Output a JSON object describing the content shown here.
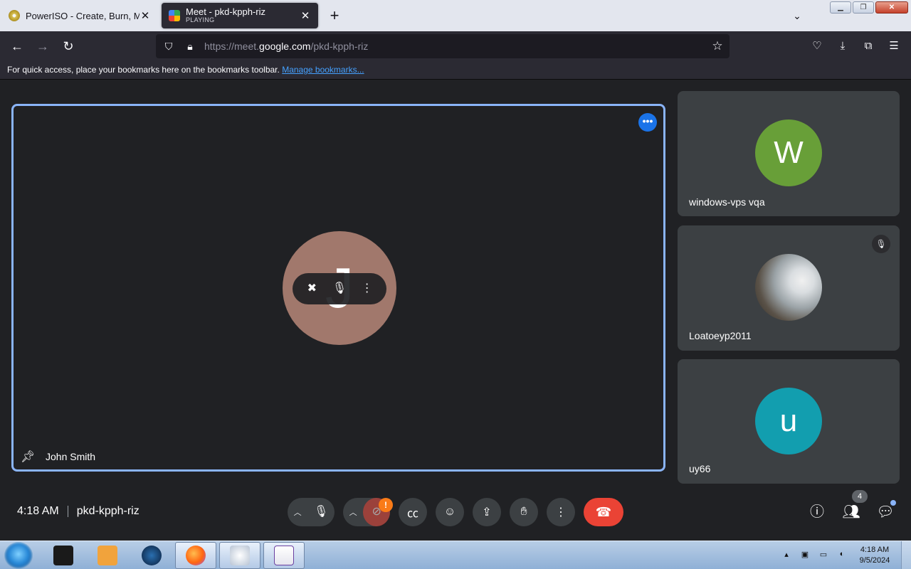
{
  "browser": {
    "tabs": [
      {
        "title": "PowerISO - Create, Burn, Mount",
        "subtitle": ""
      },
      {
        "title": "Meet - pkd-kpph-riz",
        "subtitle": "PLAYING"
      }
    ],
    "url": {
      "prefix": "https://meet.",
      "host": "google.com",
      "path": "/pkd-kpph-riz"
    },
    "bookmarks_text": "For quick access, place your bookmarks here on the bookmarks toolbar.",
    "bookmarks_link": "Manage bookmarks..."
  },
  "meet": {
    "main": {
      "name": "John Smith",
      "initial": "J"
    },
    "participants": [
      {
        "name": "windows-vps vqa",
        "initial": "W",
        "color": "#689f38"
      },
      {
        "name": "Loatoeyp2011",
        "initial": "",
        "muted": true
      },
      {
        "name": "uy66",
        "initial": "u",
        "color": "#129eaf"
      }
    ],
    "time": "4:18 AM",
    "code": "pkd-kpph-riz",
    "people_count": "4",
    "camera_warning": "!"
  },
  "taskbar": {
    "time": "4:18 AM",
    "date": "9/5/2024"
  },
  "colors": {
    "accent": "#8ab4f8",
    "leave": "#ea4335",
    "link": "#45a1ff"
  }
}
